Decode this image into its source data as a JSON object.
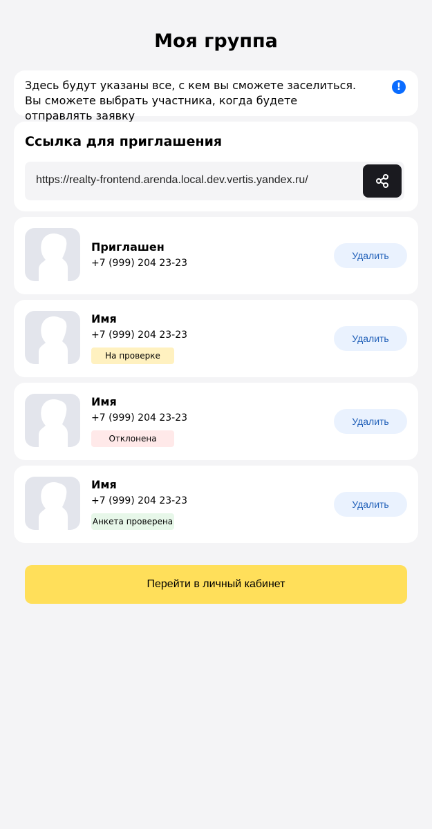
{
  "page": {
    "title": "Моя группа"
  },
  "info": {
    "text": "Здесь будут указаны все, с кем вы сможете заселиться. Вы сможете выбрать участника, когда будете отправлять заявку",
    "icon": "exclamation-icon",
    "icon_glyph": "!",
    "icon_color": "#0a6cff"
  },
  "invite": {
    "title": "Ссылка для приглашения",
    "link": "https://realty-frontend.arenda.local.dev.vertis.yandex.ru/",
    "share_icon": "share-icon"
  },
  "members": [
    {
      "name": "Приглашен",
      "phone": "+7 (999) 204 23-23",
      "status": "",
      "delete_label": "Удалить"
    },
    {
      "name": "Имя",
      "phone": "+7 (999) 204 23-23",
      "status": "На проверке",
      "delete_label": "Удалить"
    },
    {
      "name": "Имя",
      "phone": "+7 (999) 204 23-23",
      "status": "Отклонена",
      "delete_label": "Удалить"
    },
    {
      "name": "Имя",
      "phone": "+7 (999) 204 23-23",
      "status": "Анкета проверена",
      "delete_label": "Удалить"
    }
  ],
  "colors": {
    "background": "#f4f4f6",
    "primary_button": "#ffdf5a",
    "share_button": "#1a1a1f",
    "delete_button": "#eaf2fe",
    "delete_text": "#1f5fb8",
    "status_review": "#fff1c0",
    "status_rejected": "#ffe9e9",
    "status_ok": "#e7f7e9"
  },
  "actions": {
    "primary_label": "Перейти в личный кабинет"
  }
}
